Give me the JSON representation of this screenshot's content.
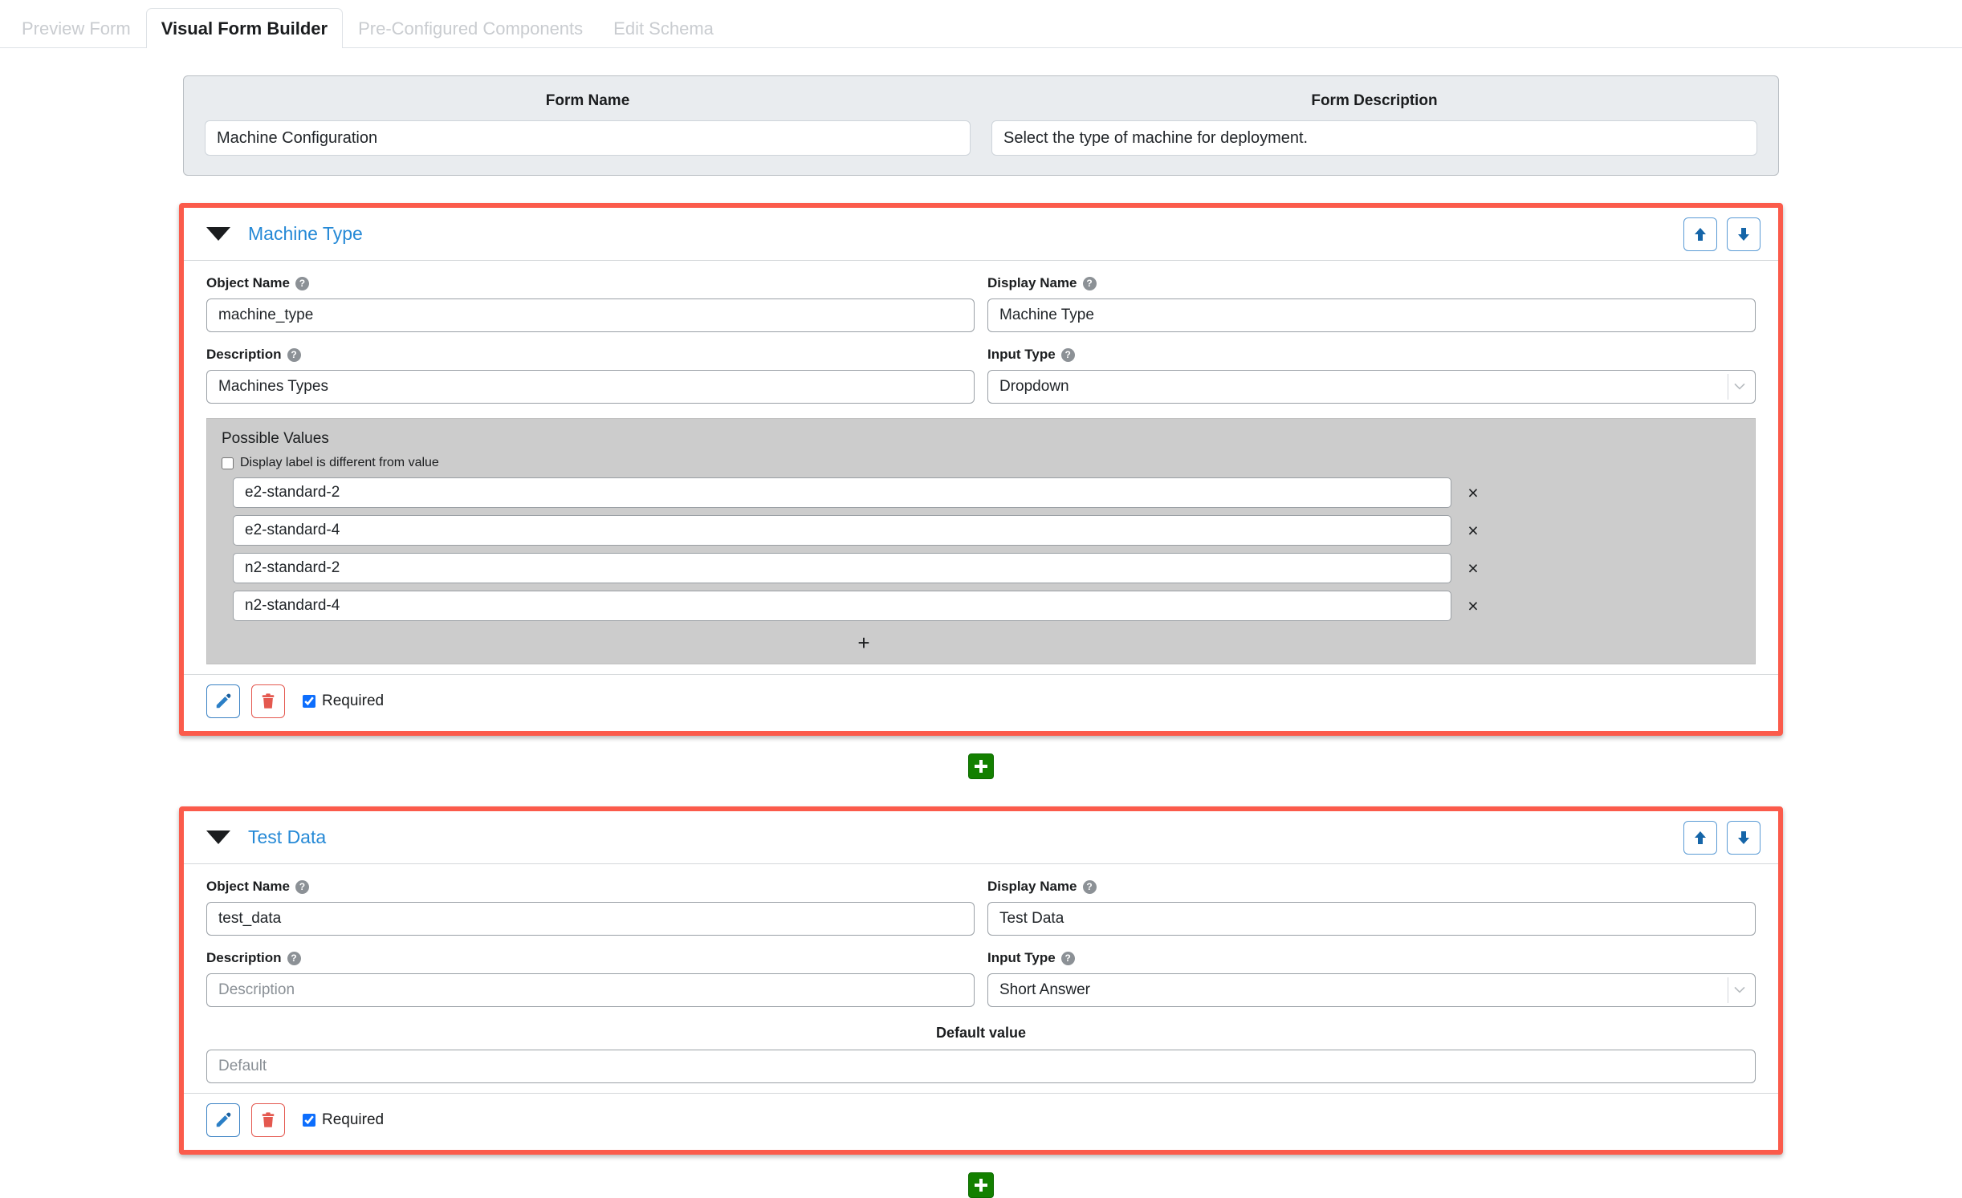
{
  "tabs": [
    {
      "label": "Preview Form",
      "active": false
    },
    {
      "label": "Visual Form Builder",
      "active": true
    },
    {
      "label": "Pre-Configured Components",
      "active": false
    },
    {
      "label": "Edit Schema",
      "active": false
    }
  ],
  "form_header": {
    "name_label": "Form Name",
    "name_value": "Machine Configuration",
    "description_label": "Form Description",
    "description_value": "Select the type of machine for deployment."
  },
  "labels": {
    "object_name": "Object Name",
    "display_name": "Display Name",
    "description": "Description",
    "input_type": "Input Type",
    "default_value": "Default value",
    "possible_values": "Possible Values",
    "display_label_different": "Display label is different from value",
    "required": "Required",
    "help_glyph": "?",
    "remove_glyph": "×",
    "add_glyph": "+"
  },
  "colors": {
    "section_outline": "#fb5b4b",
    "section_title": "#2589d6",
    "add_button": "#138000",
    "possible_values_bg": "#cccccc",
    "header_bg": "#e9ecef"
  },
  "sections": [
    {
      "title": "Machine Type",
      "object_name": "machine_type",
      "object_name_placeholder": "Object Name",
      "display_name": "Machine Type",
      "display_name_placeholder": "Display Name",
      "description": "Machines Types",
      "description_placeholder": "Description",
      "input_type": "Dropdown",
      "required": true,
      "display_label_checked": false,
      "possible_values": [
        "e2-standard-2",
        "e2-standard-4",
        "n2-standard-2",
        "n2-standard-4"
      ]
    },
    {
      "title": "Test Data",
      "object_name": "test_data",
      "object_name_placeholder": "Object Name",
      "display_name": "Test Data",
      "display_name_placeholder": "Display Name",
      "description": "",
      "description_placeholder": "Description",
      "input_type": "Short Answer",
      "required": true,
      "default_value": "",
      "default_value_placeholder": "Default"
    }
  ]
}
